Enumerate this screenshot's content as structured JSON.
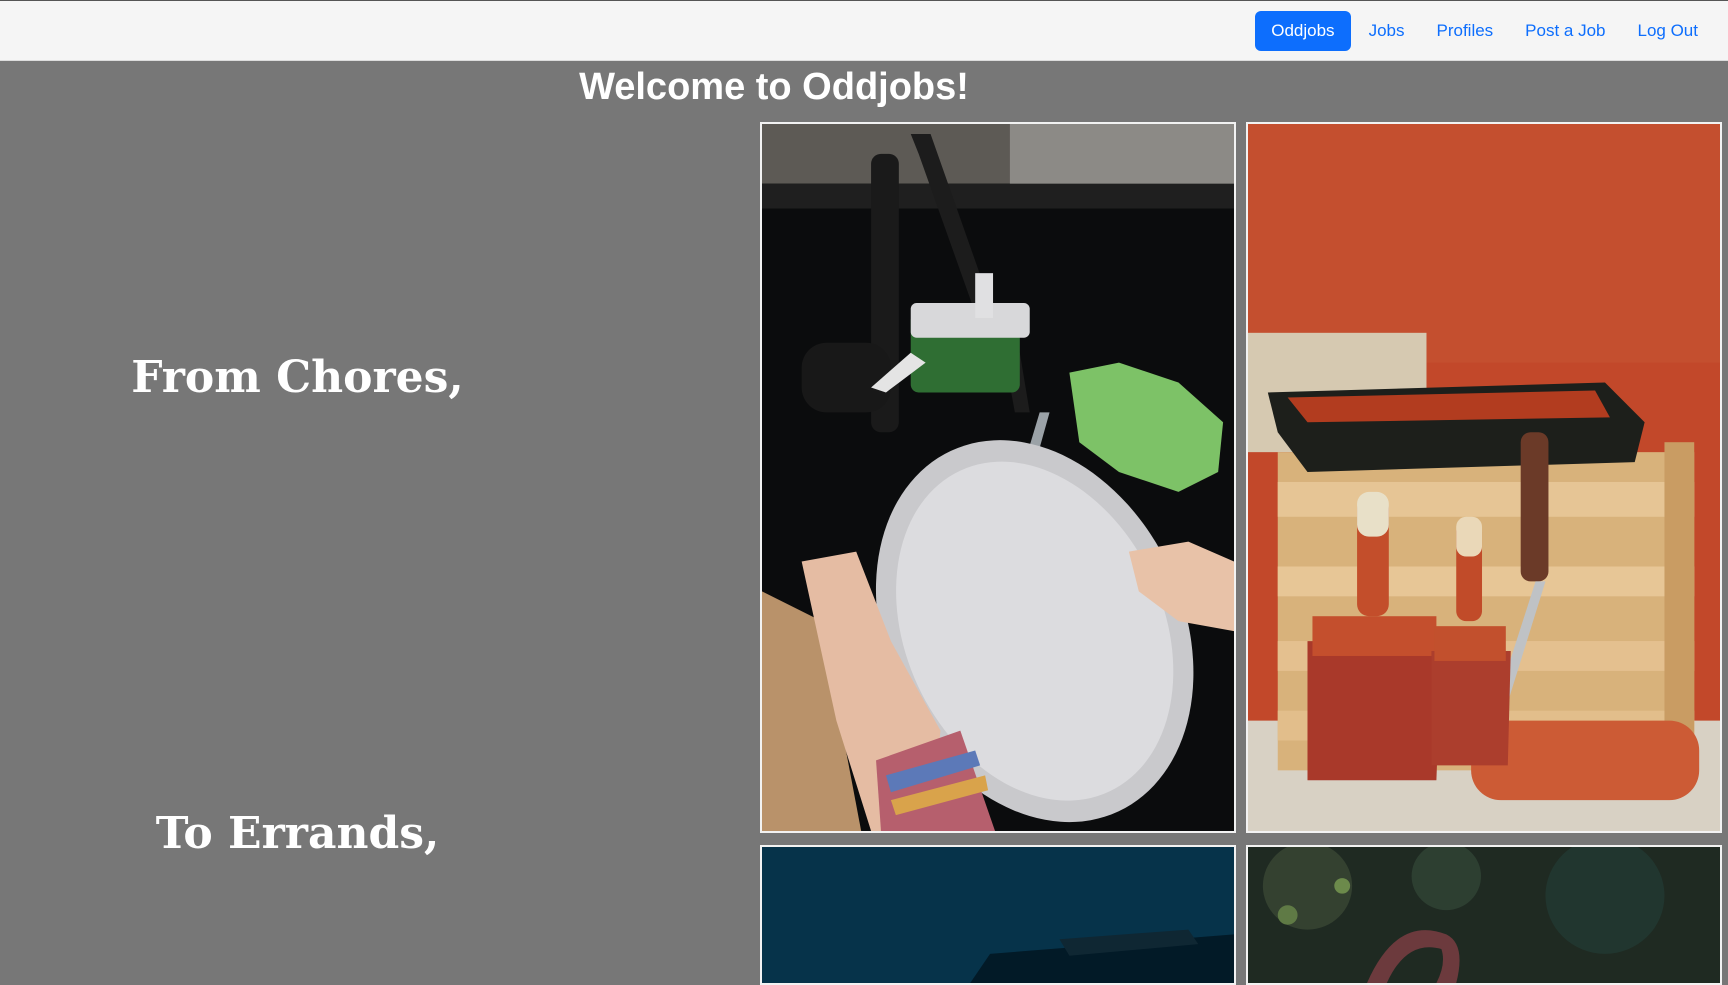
{
  "nav": {
    "brand": "Oddjobs",
    "items": [
      {
        "label": "Jobs"
      },
      {
        "label": "Profiles"
      },
      {
        "label": "Post a Job"
      },
      {
        "label": "Log Out"
      }
    ]
  },
  "hero": {
    "title": "Welcome to Oddjobs!",
    "taglines": [
      "From Chores,",
      "To Errands,"
    ]
  },
  "gallery": {
    "images": [
      {
        "name": "dishwashing-photo"
      },
      {
        "name": "painting-supplies-photo"
      },
      {
        "name": "teal-photo"
      },
      {
        "name": "garden-photo"
      }
    ]
  },
  "colors": {
    "background": "#777777",
    "navbar": "#f5f5f5",
    "accent": "#0d6efd",
    "text": "#ffffff"
  }
}
